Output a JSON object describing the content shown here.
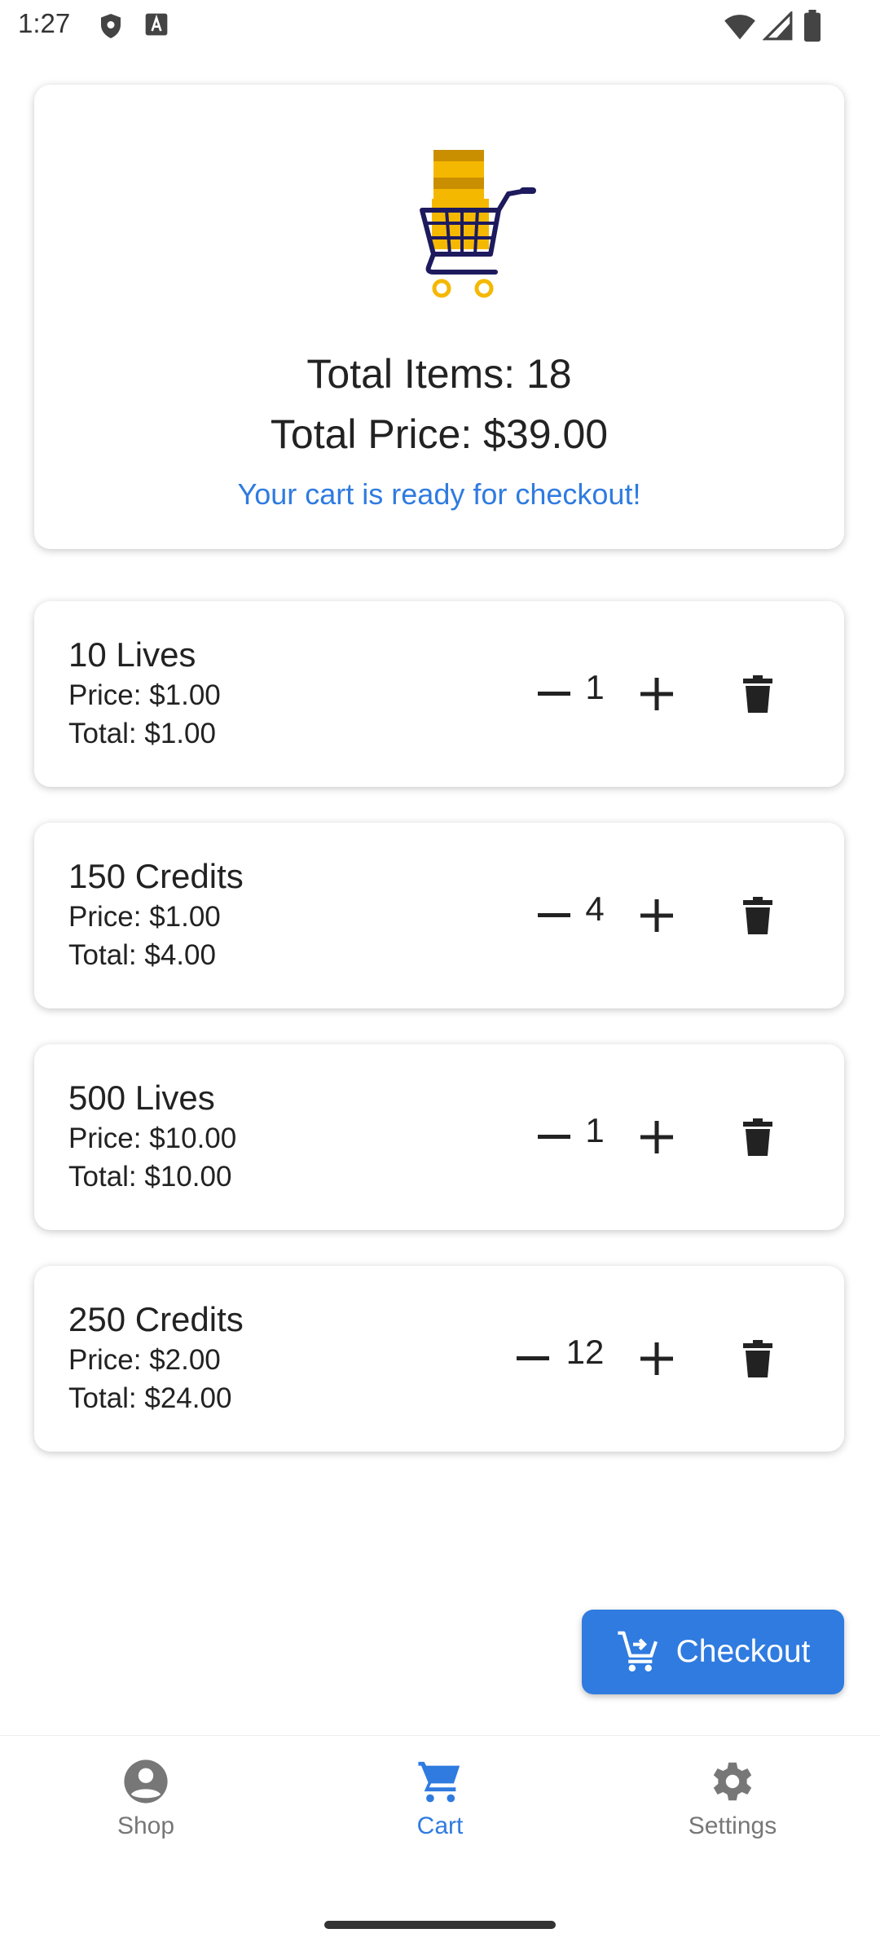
{
  "status_bar": {
    "time": "1:27"
  },
  "summary": {
    "total_items_text": "Total Items: 18",
    "total_price_text": "Total Price: $39.00",
    "status_message": "Your cart is ready for checkout!"
  },
  "cart_items": [
    {
      "name": "10 Lives",
      "price_text": "Price: $1.00",
      "total_text": "Total: $1.00",
      "quantity": "1"
    },
    {
      "name": "150 Credits",
      "price_text": "Price: $1.00",
      "total_text": "Total: $4.00",
      "quantity": "4"
    },
    {
      "name": "500 Lives",
      "price_text": "Price: $10.00",
      "total_text": "Total: $10.00",
      "quantity": "1"
    },
    {
      "name": "250 Credits",
      "price_text": "Price: $2.00",
      "total_text": "Total: $24.00",
      "quantity": "12"
    }
  ],
  "checkout": {
    "label": "Checkout",
    "icon": "cart-checkout-icon"
  },
  "bottom_nav": {
    "items": [
      {
        "label": "Shop",
        "icon": "account-circle-icon",
        "active": false
      },
      {
        "label": "Cart",
        "icon": "cart-icon",
        "active": true
      },
      {
        "label": "Settings",
        "icon": "gear-icon",
        "active": false
      }
    ]
  },
  "colors": {
    "accent": "#2f7be0",
    "text_primary": "#222222",
    "nav_inactive": "#777777",
    "illustration_yellow": "#f5b800",
    "illustration_navy": "#1d1a5e"
  }
}
